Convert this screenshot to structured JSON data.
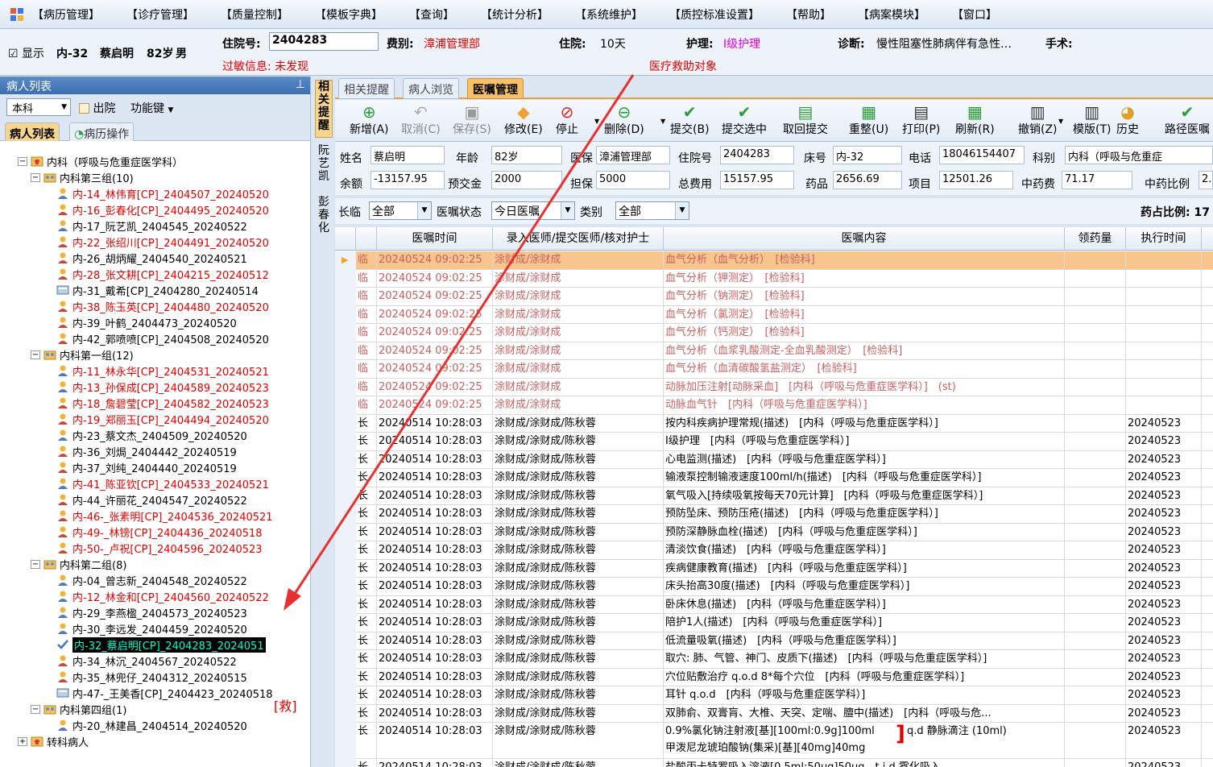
{
  "menu": [
    "【病历管理】",
    "【诊疗管理】",
    "【质量控制】",
    "【模板字典】",
    "【查询】",
    "【统计分析】",
    "【系统维护】",
    "【质控标准设置】",
    "【帮助】",
    "【病案模块】",
    "【窗口】"
  ],
  "patient": {
    "show_label": "显示",
    "bed": "内-32",
    "name": "蔡启明",
    "age": "82岁",
    "sex": "男",
    "inhos_label": "住院号:",
    "inhos_value": "2404283",
    "fee_label": "费别:",
    "fee_value": "漳浦管理部",
    "stay_label": "住院:",
    "stay_value": "10天",
    "nurse_label": "护理:",
    "nurse_value": "I级护理",
    "diag_label": "诊断:",
    "diag_value": "慢性阻塞性肺病伴有急性…",
    "surgery_label": "手术:",
    "allergy": "过敏信息: 未发现",
    "rescue": "医疗救助对象"
  },
  "left": {
    "title": "病人列表",
    "pin": "⊥",
    "dept": "本科",
    "discharge": "出院",
    "function_key": "功能键",
    "tab1": "病人列表",
    "tab2": "病历操作",
    "rescue_mark": "[救]"
  },
  "tree": [
    {
      "t": "内科（呼吸与危重症医学科）",
      "lv": 0,
      "type": "dept",
      "c": "#000"
    },
    {
      "t": "内科第三组(10)",
      "lv": 1,
      "type": "group",
      "c": "#000"
    },
    {
      "t": "内-14_林伟育[CP]_2404507_20240520",
      "lv": 2,
      "type": "pm",
      "c": "#e00000"
    },
    {
      "t": "内-16_彭春化[CP]_2404495_20240520",
      "lv": 2,
      "type": "pf",
      "c": "#e00000"
    },
    {
      "t": "内-17_阮艺凯_2404545_20240522",
      "lv": 2,
      "type": "pm",
      "c": "#000"
    },
    {
      "t": "内-22_张绍川[CP]_2404491_20240520",
      "lv": 2,
      "type": "pf",
      "c": "#e00000"
    },
    {
      "t": "内-26_胡炳耀_2404540_20240521",
      "lv": 2,
      "type": "pf",
      "c": "#000"
    },
    {
      "t": "内-28_张文耕[CP]_2404215_20240512",
      "lv": 2,
      "type": "pf",
      "c": "#e00000"
    },
    {
      "t": "内-31_戴希[CP]_2404280_20240514",
      "lv": 2,
      "type": "pc",
      "c": "#000"
    },
    {
      "t": "内-38_陈玉英[CP]_2404480_20240520",
      "lv": 2,
      "type": "pf",
      "c": "#e00000"
    },
    {
      "t": "内-39_叶鹤_2404473_20240520",
      "lv": 2,
      "type": "pf",
      "c": "#000"
    },
    {
      "t": "内-42_郭喷喷[CP]_2404508_20240520",
      "lv": 2,
      "type": "pf",
      "c": "#000"
    },
    {
      "t": "内科第一组(12)",
      "lv": 1,
      "type": "group",
      "c": "#000"
    },
    {
      "t": "内-11_林永华[CP]_2404531_20240521",
      "lv": 2,
      "type": "pm",
      "c": "#e00000"
    },
    {
      "t": "内-13_孙保成[CP]_2404589_20240523",
      "lv": 2,
      "type": "pm",
      "c": "#e00000"
    },
    {
      "t": "内-18_詹碧莹[CP]_2404582_20240523",
      "lv": 2,
      "type": "pf",
      "c": "#e00000"
    },
    {
      "t": "内-19_郑丽玉[CP]_2404494_20240520",
      "lv": 2,
      "type": "pf",
      "c": "#e00000"
    },
    {
      "t": "内-23_蔡文杰_2404509_20240520",
      "lv": 2,
      "type": "pm",
      "c": "#000"
    },
    {
      "t": "内-36_刘焗_2404442_20240519",
      "lv": 2,
      "type": "pf",
      "c": "#000"
    },
    {
      "t": "内-37_刘纯_2404440_20240519",
      "lv": 2,
      "type": "pf",
      "c": "#000"
    },
    {
      "t": "内-41_陈亚钦[CP]_2404533_20240521",
      "lv": 2,
      "type": "pm",
      "c": "#e00000"
    },
    {
      "t": "内-44_许丽花_2404547_20240522",
      "lv": 2,
      "type": "pf",
      "c": "#000"
    },
    {
      "t": "内-46-_张素明[CP]_2404536_20240521",
      "lv": 2,
      "type": "pf",
      "c": "#e00000"
    },
    {
      "t": "内-49-_林镑[CP]_2404436_20240518",
      "lv": 2,
      "type": "pf",
      "c": "#e00000"
    },
    {
      "t": "内-50-_卢祝[CP]_2404596_20240523",
      "lv": 2,
      "type": "pf",
      "c": "#e00000"
    },
    {
      "t": "内科第二组(8)",
      "lv": 1,
      "type": "group",
      "c": "#000"
    },
    {
      "t": "内-04_曾志新_2404548_20240522",
      "lv": 2,
      "type": "pm",
      "c": "#000"
    },
    {
      "t": "内-12_林金和[CP]_2404560_20240522",
      "lv": 2,
      "type": "pm",
      "c": "#e00000"
    },
    {
      "t": "内-29_李燕楹_2404573_20240523",
      "lv": 2,
      "type": "pm",
      "c": "#000"
    },
    {
      "t": "内-30_李远发_2404459_20240520",
      "lv": 2,
      "type": "pm",
      "c": "#000"
    },
    {
      "t": "内-32_蔡启明[CP]_2404283_2024051",
      "lv": 2,
      "type": "pk",
      "c": "#00ffd0",
      "sel": true
    },
    {
      "t": "内-34_林沉_2404567_20240522",
      "lv": 2,
      "type": "pf",
      "c": "#000"
    },
    {
      "t": "内-35_林兜仔_2404312_20240515",
      "lv": 2,
      "type": "pf",
      "c": "#000"
    },
    {
      "t": "内-47-_王美香[CP]_2404423_20240518",
      "lv": 2,
      "type": "pc",
      "c": "#000"
    },
    {
      "t": "内科第四组(1)",
      "lv": 1,
      "type": "group",
      "c": "#000"
    },
    {
      "t": "内-20_林建昌_2404514_20240520",
      "lv": 2,
      "type": "pm",
      "c": "#000"
    },
    {
      "t": "转科病人",
      "lv": 0,
      "type": "dept",
      "c": "#000"
    }
  ],
  "vtabs": [
    "相关提醒",
    "阮艺凯",
    "彭春化"
  ],
  "rtabs": [
    "相关提醒",
    "病人浏览",
    "医嘱管理"
  ],
  "toolbar": [
    {
      "l": "新增(A)",
      "i": "add-icon",
      "dis": false
    },
    {
      "l": "取消(C)",
      "i": "undo-icon",
      "dis": true
    },
    {
      "l": "保存(S)",
      "i": "save-icon",
      "dis": true
    },
    {
      "l": "修改(E)",
      "i": "eraser-icon",
      "dis": false
    },
    {
      "l": "停止",
      "i": "stop-icon",
      "dis": false
    },
    {
      "l": "删除(D)",
      "i": "delete-icon",
      "dis": false
    },
    {
      "l": "提交(B)",
      "i": "submit-icon",
      "dis": false
    },
    {
      "l": "提交选中",
      "i": "submit-selected-icon",
      "dis": false
    },
    {
      "l": "取回提交",
      "i": "retrieve-icon",
      "dis": false
    },
    {
      "l": "重整(U)",
      "i": "reorganize-icon",
      "dis": false
    },
    {
      "l": "打印(P)",
      "i": "print-icon",
      "dis": false
    },
    {
      "l": "刷新(R)",
      "i": "refresh-icon",
      "dis": false
    },
    {
      "l": "撤销(Z)",
      "i": "revoke-icon",
      "dis": false
    },
    {
      "l": "模版(T)",
      "i": "template-icon",
      "dis": false
    },
    {
      "l": "历史",
      "i": "history-icon",
      "dis": false
    },
    {
      "l": "路径医嘱",
      "i": "path-icon",
      "dis": false
    }
  ],
  "info": {
    "name_l": "姓名",
    "name": "蔡启明",
    "age_l": "年龄",
    "age": "82岁",
    "ins_l": "医保",
    "ins": "漳浦管理部",
    "inhos_l": "住院号",
    "inhos": "2404283",
    "bed_l": "床号",
    "bed": "内-32",
    "tel_l": "电话",
    "tel": "18046154407",
    "dept_l": "科别",
    "dept": "内科（呼吸与危重症",
    "bal_l": "余额",
    "bal": "-13157.95",
    "pre_l": "预交金",
    "pre": "2000",
    "guar_l": "担保",
    "guar": "5000",
    "total_l": "总费用",
    "total": "15157.95",
    "drug_l": "药品",
    "drug": "2656.69",
    "item_l": "项目",
    "item": "12501.26",
    "tcm_l": "中药费",
    "tcm": "71.17",
    "tcmr_l": "中药比例",
    "tcmr": "2."
  },
  "filter": {
    "type_l": "长临",
    "type": "全部",
    "status_l": "医嘱状态",
    "status": "今日医嘱",
    "cat_l": "类别",
    "cat": "全部",
    "ratio": "药占比例: 17"
  },
  "grid": {
    "headers": [
      "",
      "医嘱时间",
      "录入医师/提交医师/核对护士",
      "医嘱内容",
      "领药量",
      "执行时间"
    ],
    "rows": [
      {
        "k": "临",
        "t": "20240524 09:02:25",
        "d": "涂财成/涂财成",
        "c": "血气分析（血气分析）　[检验科]",
        "e": "",
        "s": "sel"
      },
      {
        "k": "临",
        "t": "20240524 09:02:25",
        "d": "涂财成/涂财成",
        "c": "血气分析（钾测定）　[检验科]",
        "e": "",
        "s": "ls"
      },
      {
        "k": "临",
        "t": "20240524 09:02:25",
        "d": "涂财成/涂财成",
        "c": "血气分析（钠测定）　[检验科]",
        "e": "",
        "s": "ls"
      },
      {
        "k": "临",
        "t": "20240524 09:02:25",
        "d": "涂财成/涂财成",
        "c": "血气分析（氯测定）　[检验科]",
        "e": "",
        "s": "ls"
      },
      {
        "k": "临",
        "t": "20240524 09:02:25",
        "d": "涂财成/涂财成",
        "c": "血气分析（钙测定）　[检验科]",
        "e": "",
        "s": "ls"
      },
      {
        "k": "临",
        "t": "20240524 09:02:25",
        "d": "涂财成/涂财成",
        "c": "血气分析（血浆乳酸测定-全血乳酸测定）　[检验科]",
        "e": "",
        "s": "ls"
      },
      {
        "k": "临",
        "t": "20240524 09:02:25",
        "d": "涂财成/涂财成",
        "c": "血气分析（血清碳酸氢盐测定）　[检验科]",
        "e": "",
        "s": "ls"
      },
      {
        "k": "临",
        "t": "20240524 09:02:25",
        "d": "涂财成/涂财成",
        "c": "动脉加压注射[动脉采血]　[内科（呼吸与危重症医学科）]　(st)",
        "e": "",
        "s": "ls"
      },
      {
        "k": "临",
        "t": "20240524 09:02:25",
        "d": "涂财成/涂财成",
        "c": "动脉血气针　[内科（呼吸与危重症医学科）]",
        "e": "",
        "s": "ls"
      },
      {
        "k": "长",
        "t": "20240514 10:28:03",
        "d": "涂财成/涂财成/陈秋蓉",
        "c": "按内科疾病护理常规(描述)　[内科（呼吸与危重症医学科）]",
        "e": "20240523",
        "s": ""
      },
      {
        "k": "长",
        "t": "20240514 10:28:03",
        "d": "涂财成/涂财成/陈秋蓉",
        "c": "I级护理　[内科（呼吸与危重症医学科）]",
        "e": "20240523",
        "s": ""
      },
      {
        "k": "长",
        "t": "20240514 10:28:03",
        "d": "涂财成/涂财成/陈秋蓉",
        "c": "心电监测(描述)　[内科（呼吸与危重症医学科）]",
        "e": "20240523",
        "s": ""
      },
      {
        "k": "长",
        "t": "20240514 10:28:03",
        "d": "涂财成/涂财成/陈秋蓉",
        "c": "输液泵控制输液速度100ml/h(描述)　[内科（呼吸与危重症医学科）]",
        "e": "20240523",
        "s": ""
      },
      {
        "k": "长",
        "t": "20240514 10:28:03",
        "d": "涂财成/涂财成/陈秋蓉",
        "c": "氧气吸入[持续吸氧按每天70元计算]　[内科（呼吸与危重症医学科）]",
        "e": "20240523",
        "s": ""
      },
      {
        "k": "长",
        "t": "20240514 10:28:03",
        "d": "涂财成/涂财成/陈秋蓉",
        "c": "预防坠床、预防压疮(描述)　[内科（呼吸与危重症医学科）]",
        "e": "20240523",
        "s": ""
      },
      {
        "k": "长",
        "t": "20240514 10:28:03",
        "d": "涂财成/涂财成/陈秋蓉",
        "c": "预防深静脉血栓(描述)　[内科（呼吸与危重症医学科）]",
        "e": "20240523",
        "s": ""
      },
      {
        "k": "长",
        "t": "20240514 10:28:03",
        "d": "涂财成/涂财成/陈秋蓉",
        "c": "清淡饮食(描述)　[内科（呼吸与危重症医学科）]",
        "e": "20240523",
        "s": ""
      },
      {
        "k": "长",
        "t": "20240514 10:28:03",
        "d": "涂财成/涂财成/陈秋蓉",
        "c": "疾病健康教育(描述)　[内科（呼吸与危重症医学科）]",
        "e": "20240523",
        "s": ""
      },
      {
        "k": "长",
        "t": "20240514 10:28:03",
        "d": "涂财成/涂财成/陈秋蓉",
        "c": "床头抬高30度(描述)　[内科（呼吸与危重症医学科）]",
        "e": "20240523",
        "s": ""
      },
      {
        "k": "长",
        "t": "20240514 10:28:03",
        "d": "涂财成/涂财成/陈秋蓉",
        "c": "卧床休息(描述)　[内科（呼吸与危重症医学科）]",
        "e": "20240523",
        "s": ""
      },
      {
        "k": "长",
        "t": "20240514 10:28:03",
        "d": "涂财成/涂财成/陈秋蓉",
        "c": "陪护1人(描述)　[内科（呼吸与危重症医学科）]",
        "e": "20240523",
        "s": ""
      },
      {
        "k": "长",
        "t": "20240514 10:28:03",
        "d": "涂财成/涂财成/陈秋蓉",
        "c": "低流量吸氧(描述)　[内科（呼吸与危重症医学科）]",
        "e": "20240523",
        "s": ""
      },
      {
        "k": "长",
        "t": "20240514 10:28:03",
        "d": "涂财成/涂财成/陈秋蓉",
        "c": "取穴: 肺、气管、神门、皮质下(描述)　[内科（呼吸与危重症医学科）]",
        "e": "20240523",
        "s": ""
      },
      {
        "k": "长",
        "t": "20240514 10:28:03",
        "d": "涂财成/涂财成/陈秋蓉",
        "c": "穴位贴敷治疗 q.o.d 8*每个穴位　[内科（呼吸与危重症医学科）]",
        "e": "20240523",
        "s": ""
      },
      {
        "k": "长",
        "t": "20240514 10:28:03",
        "d": "涂财成/涂财成/陈秋蓉",
        "c": "耳针 q.o.d　[内科（呼吸与危重症医学科）]",
        "e": "20240523",
        "s": ""
      },
      {
        "k": "长",
        "t": "20240514 10:28:03",
        "d": "涂财成/涂财成/陈秋蓉",
        "c": "双肺俞、双膏肓、大椎、天突、定喘、膻中(描述)　[内科（呼吸与危...",
        "e": "20240523",
        "s": ""
      }
    ],
    "multi": {
      "k": "长",
      "t": "20240514 10:28:03",
      "d": "涂财成/涂财成/陈秋蓉",
      "c1": "0.9%氯化钠注射液[基][100ml:0.9g]100ml",
      "c2": "甲泼尼龙琥珀酸钠(集采)[基][40mg]40mg",
      "tail": "q.d 静脉滴注 (10ml)",
      "e": "20240523"
    },
    "last": {
      "k": "长",
      "t": "20240514 10:28:03",
      "d": "涂财成/涂财成/陈秋蓉",
      "c": "盐酸丙卡特罗吸入溶液[0.5ml:50ug]50ug　t.i.d 雾化吸入",
      "e": "20240523"
    }
  },
  "colors": {
    "accent": "#e8a43b",
    "selected_row": "#f8c68d",
    "temp_row": "#c86060",
    "red": "#e00000",
    "arrow": "#e83030"
  }
}
